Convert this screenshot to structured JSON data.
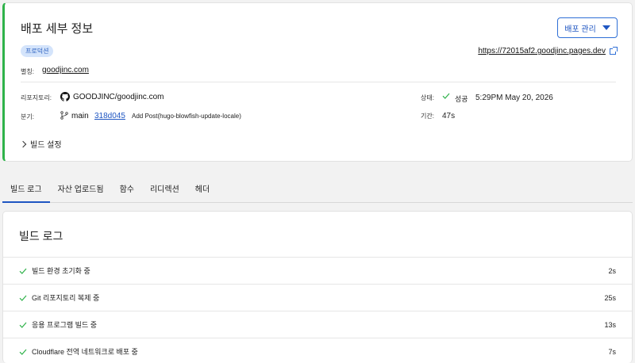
{
  "details": {
    "title": "배포 세부 정보",
    "manage_label": "배포 관리",
    "environment_badge": "프로덕션",
    "deploy_url": "https://72015af2.goodjinc.pages.dev",
    "alias_label": "별칭:",
    "alias": "goodjinc.com",
    "repo_label": "리포지토리:",
    "repo": "GOODJINC/goodjinc.com",
    "branch_label": "분기:",
    "branch": "main",
    "commit_hash": "318d045",
    "commit_message": "Add Post(hugo-blowfish-update-locale)",
    "status_label": "상태:",
    "status": "성공",
    "status_time": "5:29PM May 20, 2026",
    "duration_label": "기간:",
    "duration": "47s",
    "build_settings_label": "빌드 설정"
  },
  "tabs": [
    {
      "label": "빌드 로그"
    },
    {
      "label": "자산 업로드됨"
    },
    {
      "label": "함수"
    },
    {
      "label": "리디렉션"
    },
    {
      "label": "헤더"
    }
  ],
  "build_log": {
    "title": "빌드 로그",
    "steps": [
      {
        "label": "빌드 환경 초기화 중",
        "duration": "2s"
      },
      {
        "label": "Git 리포지토리 복제 중",
        "duration": "25s"
      },
      {
        "label": "응용 프로그램 빌드 중",
        "duration": "13s"
      },
      {
        "label": "Cloudflare 전역 네트워크로 배포 중",
        "duration": "7s"
      }
    ]
  },
  "colors": {
    "accent": "#1f56c2",
    "success": "#2fb24a",
    "badge_bg": "#d4e4fb"
  }
}
